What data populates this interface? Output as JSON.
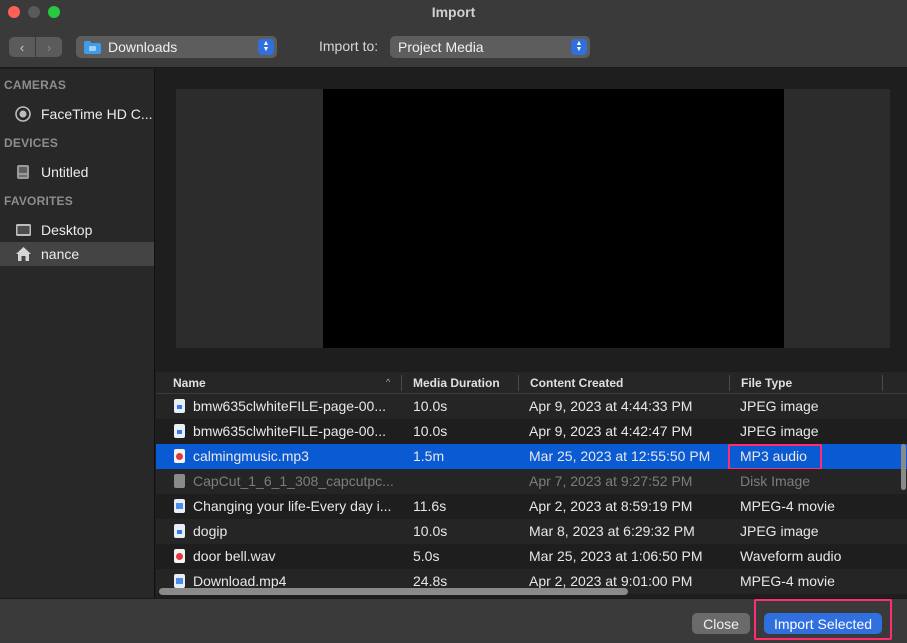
{
  "window": {
    "title": "Import"
  },
  "toolbar": {
    "back_glyph": "‹",
    "forward_glyph": "›",
    "location": "Downloads",
    "import_to_label": "Import to:",
    "import_to_value": "Project Media"
  },
  "sidebar": {
    "cameras_heading": "CAMERAS",
    "devices_heading": "DEVICES",
    "favorites_heading": "FAVORITES",
    "camera": "FaceTime HD C...",
    "device": "Untitled",
    "favorite_desktop": "Desktop",
    "favorite_home": "nance"
  },
  "table": {
    "columns": [
      "Name",
      "Media Duration",
      "Content Created",
      "File Type"
    ],
    "sort_indicator": "^",
    "rows": [
      {
        "name": "bmw635clwhiteFILE-page-00...",
        "duration": "10.0s",
        "created": "Apr 9, 2023 at 4:44:33 PM",
        "type": "JPEG image",
        "icon": "image-file-icon"
      },
      {
        "name": "bmw635clwhiteFILE-page-00...",
        "duration": "10.0s",
        "created": "Apr 9, 2023 at 4:42:47 PM",
        "type": "JPEG image",
        "icon": "image-file-icon"
      },
      {
        "name": "calmingmusic.mp3",
        "duration": "1.5m",
        "created": "Mar 25, 2023 at 12:55:50 PM",
        "type": "MP3 audio",
        "icon": "audio-file-icon",
        "selected": true
      },
      {
        "name": "CapCut_1_6_1_308_capcutpc...",
        "duration": "",
        "created": "Apr 7, 2023 at 9:27:52 PM",
        "type": "Disk Image",
        "icon": "disk-image-icon",
        "disabled": true
      },
      {
        "name": "Changing your life-Every day i...",
        "duration": "11.6s",
        "created": "Apr 2, 2023 at 8:59:19 PM",
        "type": "MPEG-4 movie",
        "icon": "movie-file-icon"
      },
      {
        "name": "dogip",
        "duration": "10.0s",
        "created": "Mar 8, 2023 at 6:29:32 PM",
        "type": "JPEG image",
        "icon": "image-file-icon"
      },
      {
        "name": "door bell.wav",
        "duration": "5.0s",
        "created": "Mar 25, 2023 at 1:06:50 PM",
        "type": "Waveform audio",
        "icon": "audio-file-icon"
      },
      {
        "name": "Download.mp4",
        "duration": "24.8s",
        "created": "Apr 2, 2023 at 9:01:00 PM",
        "type": "MPEG-4 movie",
        "icon": "movie-file-icon"
      }
    ]
  },
  "buttons": {
    "close": "Close",
    "import_selected": "Import Selected"
  },
  "colors": {
    "accent": "#2f6fde",
    "selection": "#0a5ad4",
    "highlight_box": "#ff2e72"
  }
}
